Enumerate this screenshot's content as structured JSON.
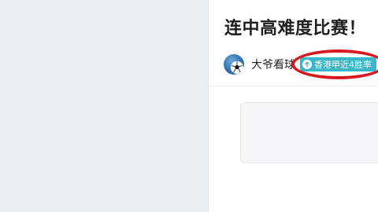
{
  "article": {
    "title": "连中高难度比赛！",
    "author": {
      "name": "大爷看球",
      "avatar_icon": "soccer-ball-icon"
    },
    "tag": {
      "label": "香港甲近4胜率",
      "icon": "arrow-up-circle-icon",
      "color": "#37b7c9"
    }
  },
  "annotation": {
    "type": "red-ellipse",
    "color": "#d71920"
  },
  "colors": {
    "left_panel_bg": "#eaedf1",
    "content_bg": "#ffffff",
    "embed_bg": "#f5f6fa"
  }
}
